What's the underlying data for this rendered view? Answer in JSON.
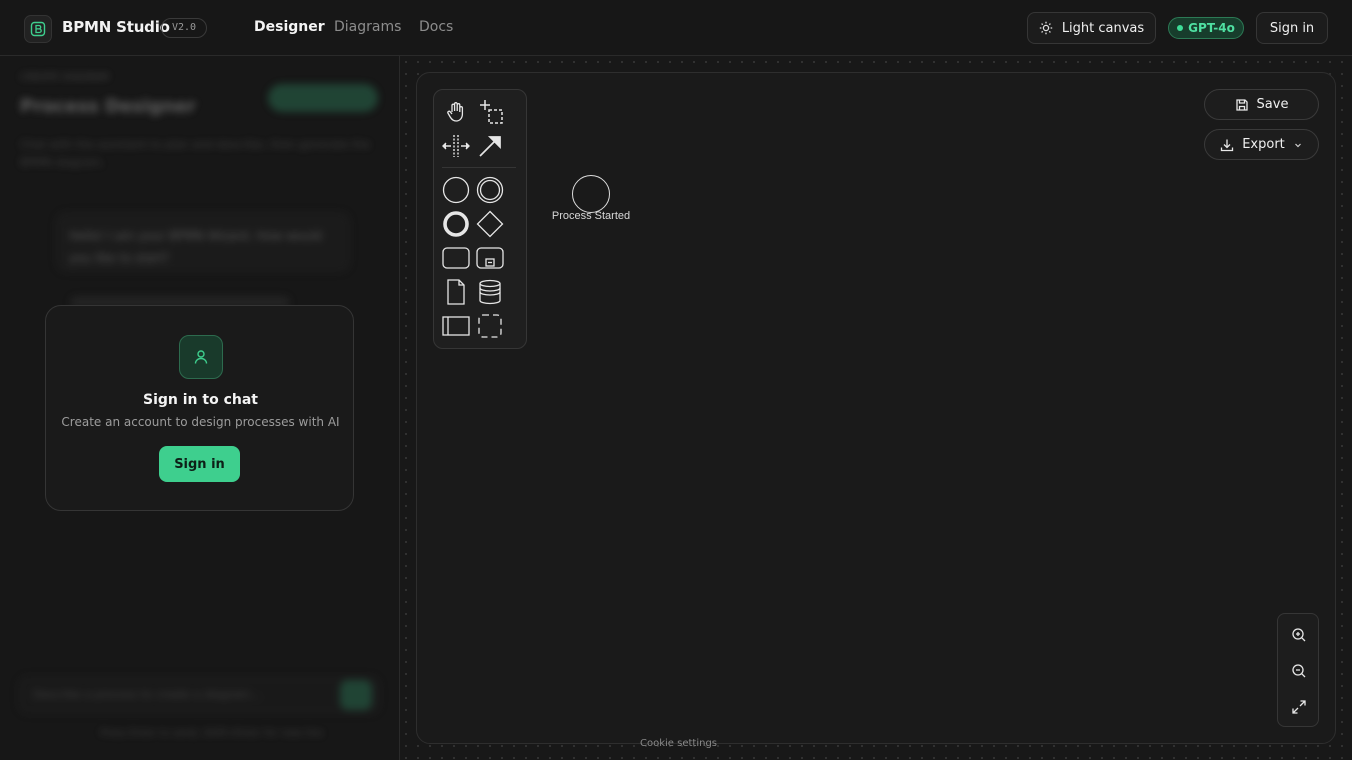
{
  "header": {
    "app_title": "BPMN Studio",
    "version": "V2.0",
    "nav": [
      "Designer",
      "Diagrams",
      "Docs"
    ],
    "active_nav": "Designer",
    "theme_toggle_label": "Light canvas",
    "model_badge": "GPT-4o",
    "signin_label": "Sign in"
  },
  "chat_panel": {
    "breadcrumb": "CREATE DIAGRAM",
    "title": "Process Designer",
    "description": "Chat with the assistant to plan and describe, then generate the BPMN diagram.",
    "assistant_message": "Hello! I am your BPMN Wizard. How would you like to start?",
    "input_placeholder": "Describe a process to create a diagram...",
    "footer": "Press Enter to send, Shift+Enter for new line"
  },
  "signin_card": {
    "title": "Sign in to chat",
    "subtitle": "Create an account to design processes with AI",
    "button_label": "Sign in"
  },
  "canvas": {
    "event_label": "Process Started",
    "save_label": "Save",
    "export_label": "Export",
    "palette_tools": [
      "hand-tool",
      "lasso-tool",
      "space-tool",
      "global-connect-tool",
      "start-event",
      "intermediate-event",
      "end-event",
      "gateway",
      "task",
      "subprocess",
      "data-object",
      "data-store",
      "pool",
      "group"
    ],
    "zoom_controls": [
      "zoom-in",
      "zoom-out",
      "fit-view"
    ]
  },
  "footer": {
    "cookie_settings": "Cookie settings"
  },
  "colors": {
    "accent": "#3ecf8e",
    "background": "#171717",
    "badge_text": "#4fe0a2"
  }
}
